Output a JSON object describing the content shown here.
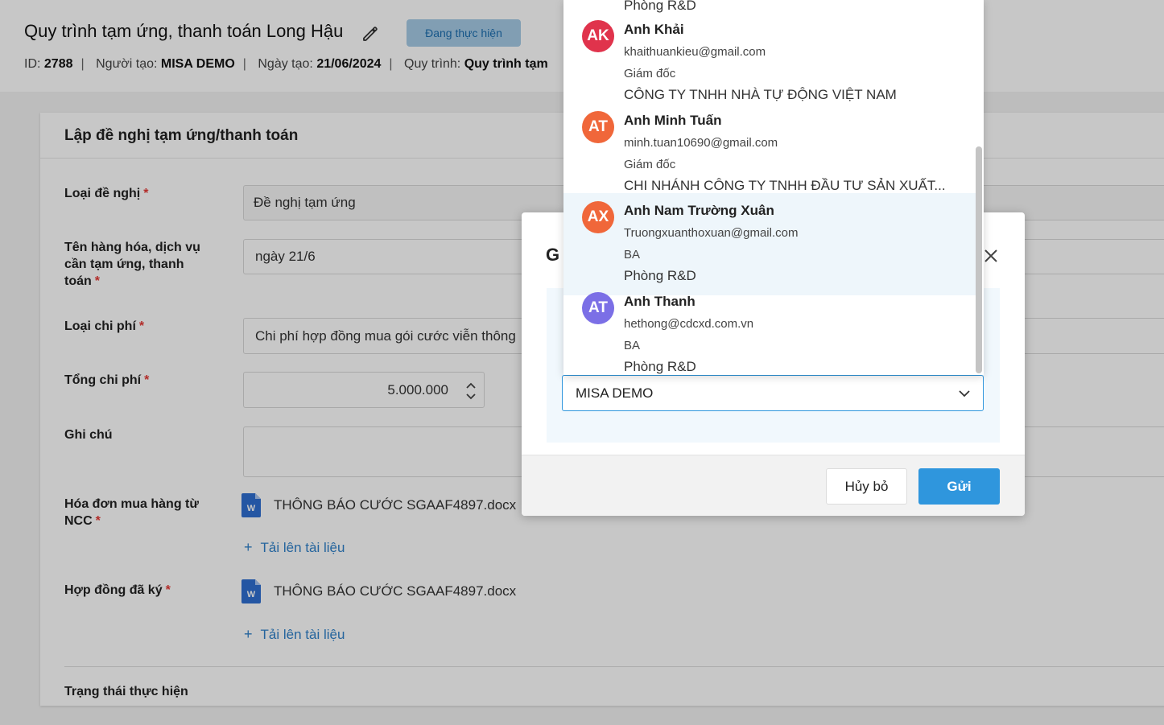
{
  "header": {
    "title": "Quy trình tạm ứng, thanh toán Long Hậu",
    "status": "Đang thực hiện",
    "meta": {
      "id_label": "ID:",
      "id_value": "2788",
      "creator_label": "Người tạo:",
      "creator_value": "MISA DEMO",
      "created_label": "Ngày tạo:",
      "created_value": "21/06/2024",
      "process_label": "Quy trình:",
      "process_value": "Quy trình tạm"
    }
  },
  "form": {
    "title": "Lập đề nghị tạm ứng/thanh toán",
    "required_mark": "*",
    "fields": {
      "request_type": {
        "label": "Loại đề nghị",
        "value": "Đề nghị tạm ứng"
      },
      "goods_name": {
        "label": "Tên hàng hóa, dịch vụ cần tạm ứng, thanh toán",
        "value": "ngày 21/6"
      },
      "cost_type": {
        "label": "Loại chi phí",
        "value": "Chi phí hợp đồng mua gói cước viễn thông"
      },
      "total_cost": {
        "label": "Tổng chi phí",
        "value": "5.000.000"
      },
      "note": {
        "label": "Ghi chú",
        "value": ""
      },
      "invoice": {
        "label": "Hóa đơn mua hàng từ NCC",
        "file": "THÔNG BÁO CƯỚC SGAAF4897.docx",
        "upload": "Tải lên tài liệu"
      },
      "contract": {
        "label": "Hợp đồng đã ký",
        "file": "THÔNG BÁO CƯỚC SGAAF4897.docx",
        "upload": "Tải lên tài liệu"
      },
      "exec_status": {
        "label": "Trạng thái thực hiện"
      }
    },
    "file_icon": "W"
  },
  "modal": {
    "title_visible": "G",
    "selected_value": "MISA DEMO",
    "cancel_label": "Hủy bỏ",
    "send_label": "Gửi"
  },
  "dropdown": {
    "top_partial_org": "Phòng R&D",
    "options": [
      {
        "initials": "AK",
        "color": "#e0334c",
        "name": "Anh Khải",
        "email": "khaithuankieu@gmail.com",
        "title": "Giám đốc",
        "org": "CÔNG TY TNHH NHÀ TỰ ĐỘNG VIỆT NAM"
      },
      {
        "initials": "AT",
        "color": "#f0673a",
        "name": "Anh Minh Tuấn",
        "email": "minh.tuan10690@gmail.com",
        "title": "Giám đốc",
        "org": "CHI NHÁNH CÔNG TY TNHH ĐẦU TƯ SẢN XUẤT..."
      },
      {
        "initials": "AX",
        "color": "#f0673a",
        "name": "Anh Nam Trường Xuân",
        "email": "Truongxuanthoxuan@gmail.com",
        "title": "BA",
        "org": "Phòng R&D"
      },
      {
        "initials": "AT",
        "color": "#7b6fe6",
        "name": "Anh Thanh",
        "email": "hethong@cdcxd.com.vn",
        "title": "BA",
        "org": "Phòng R&D"
      }
    ]
  }
}
